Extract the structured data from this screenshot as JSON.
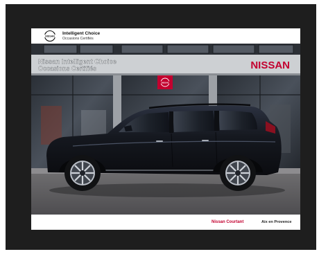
{
  "header": {
    "logo_text": "NISSAN",
    "title": "Intelligent Choice",
    "subtitle": "Occasions Certifiés"
  },
  "photo": {
    "facade_text_line1": "Nissan Intelligent Choice",
    "facade_text_line2": "Occasions Certifiés",
    "facade_brand": "NISSAN",
    "logo_panel_text": "NISSAN",
    "vehicle_color": "#15181f",
    "brand_red": "#c3002f"
  },
  "footer": {
    "dealer": "Nissan Courtant",
    "city": "Aix en Provence"
  }
}
